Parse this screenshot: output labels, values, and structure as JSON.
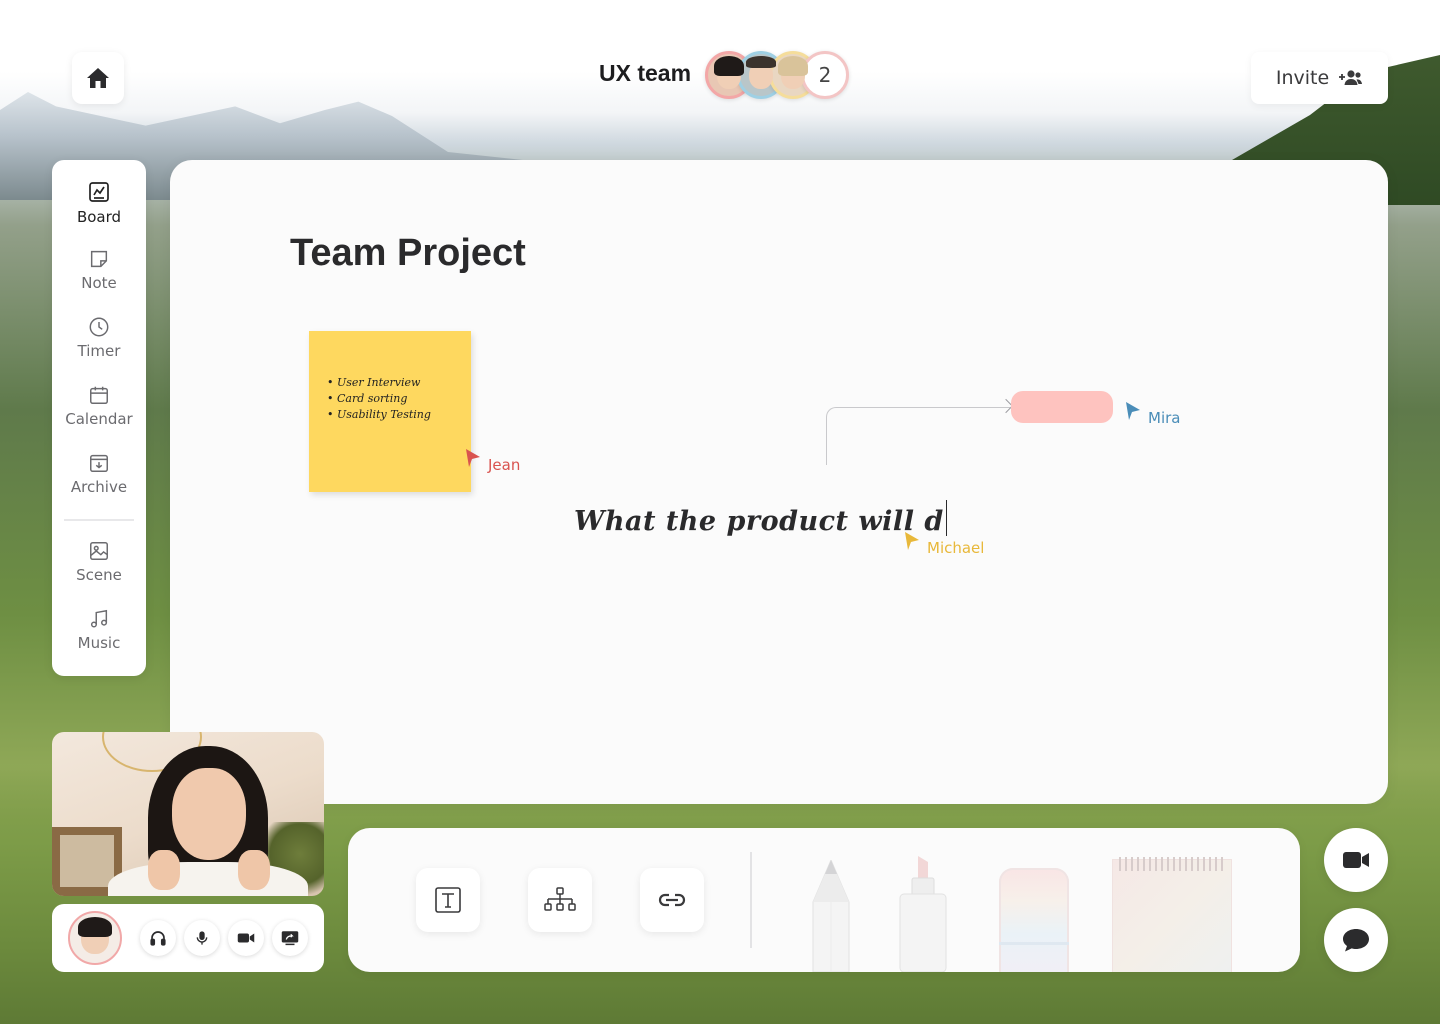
{
  "header": {
    "team_name": "UX team",
    "members": [
      {
        "name": "member-1"
      },
      {
        "name": "member-2"
      },
      {
        "name": "member-3"
      }
    ],
    "extra_members_count": "2",
    "invite_label": "Invite"
  },
  "sidebar": {
    "items": [
      {
        "label": "Board",
        "icon": "board-icon",
        "active": true
      },
      {
        "label": "Note",
        "icon": "note-icon"
      },
      {
        "label": "Timer",
        "icon": "clock-icon"
      },
      {
        "label": "Calendar",
        "icon": "calendar-icon"
      },
      {
        "label": "Archive",
        "icon": "archive-icon"
      },
      {
        "label": "Scene",
        "icon": "image-icon"
      },
      {
        "label": "Music",
        "icon": "music-icon"
      }
    ]
  },
  "board": {
    "title": "Team Project",
    "sticky_note": {
      "items": [
        "User Interview",
        "Card sorting",
        "Usability Testing"
      ],
      "color": "#fed85f"
    },
    "handwriting": "What the product will d",
    "cursors": [
      {
        "name": "Jean",
        "color": "#d9534f"
      },
      {
        "name": "Mira",
        "color": "#4a8db8"
      },
      {
        "name": "Michael",
        "color": "#e8b83a"
      }
    ],
    "shape_color": "#fec3bf"
  },
  "toolbar": {
    "tools": [
      "text-tool",
      "diagram-tool",
      "link-tool",
      "pencil",
      "highlighter",
      "eraser",
      "notepad"
    ]
  },
  "call": {
    "controls": [
      "headphones-icon",
      "microphone-icon",
      "camera-icon",
      "screen-share-icon"
    ]
  },
  "actions": {
    "video_button": "video-camera-icon",
    "chat_button": "chat-bubble-icon"
  }
}
